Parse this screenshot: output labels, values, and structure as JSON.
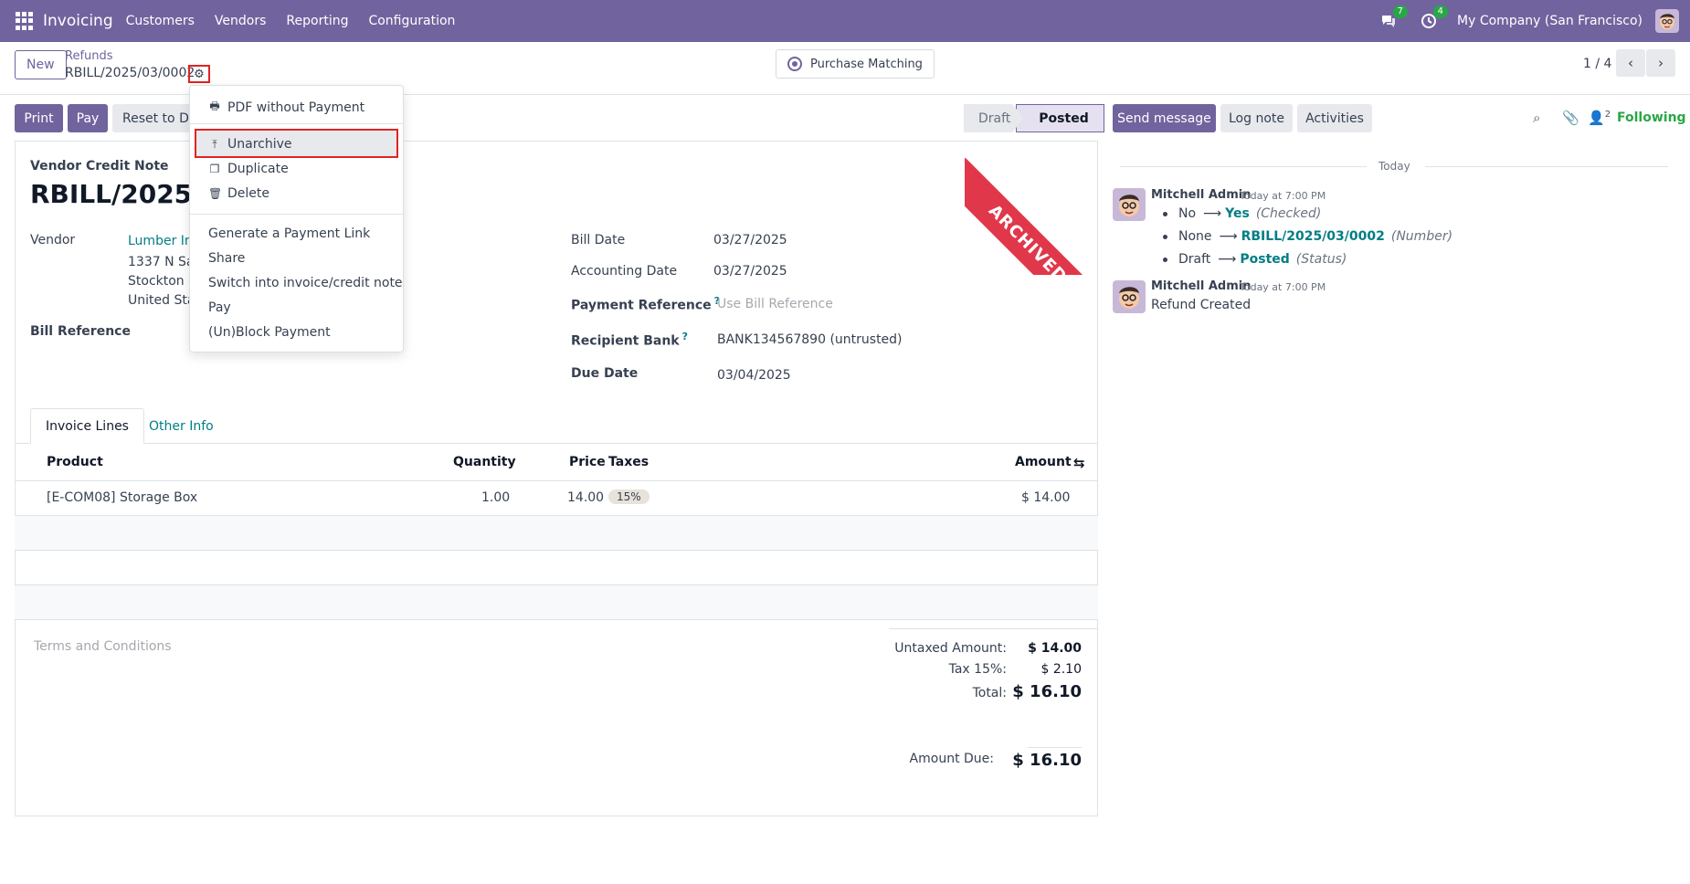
{
  "nav": {
    "app_name": "Invoicing",
    "menu": [
      "Customers",
      "Vendors",
      "Reporting",
      "Configuration"
    ],
    "messages_badge": "7",
    "activities_badge": "4",
    "company": "My Company (San Francisco)"
  },
  "control": {
    "new_label": "New",
    "breadcrumb_parent": "Refunds",
    "breadcrumb_current": "RBILL/2025/03/0002",
    "purchase_matching": "Purchase Matching",
    "pager": "1 / 4"
  },
  "actions": {
    "print": "Print",
    "pay": "Pay",
    "reset": "Reset to Dr"
  },
  "status": {
    "draft": "Draft",
    "posted": "Posted"
  },
  "ribbon": "ARCHIVED",
  "form": {
    "doc_type": "Vendor Credit Note",
    "doc_name": "RBILL/2025/03/0002",
    "vendor_label": "Vendor",
    "vendor_name": "Lumber Inc",
    "vendor_addr1": "1337 N San",
    "vendor_addr2": "Stockton C",
    "vendor_addr3": "United Sta",
    "bill_reference_label": "Bill Reference",
    "bill_date_label": "Bill Date",
    "bill_date": "03/27/2025",
    "accounting_date_label": "Accounting Date",
    "accounting_date": "03/27/2025",
    "payment_reference_label": "Payment Reference",
    "payment_reference_placeholder": "Use Bill Reference",
    "recipient_bank_label": "Recipient Bank",
    "recipient_bank": "BANK134567890 (untrusted)",
    "due_date_label": "Due Date",
    "due_date": "03/04/2025",
    "help_mark": "?"
  },
  "tabs": {
    "invoice_lines": "Invoice Lines",
    "other_info": "Other Info"
  },
  "table": {
    "headers": {
      "product": "Product",
      "quantity": "Quantity",
      "price": "Price",
      "taxes": "Taxes",
      "amount": "Amount"
    },
    "rows": [
      {
        "product": "[E-COM08] Storage Box",
        "quantity": "1.00",
        "price": "14.00",
        "tax": "15%",
        "amount": "$ 14.00"
      }
    ]
  },
  "totals": {
    "terms": "Terms and Conditions",
    "untaxed_label": "Untaxed Amount:",
    "untaxed": "$ 14.00",
    "tax_label": "Tax 15%:",
    "tax": "$ 2.10",
    "total_label": "Total:",
    "total": "$ 16.10",
    "due_label": "Amount Due:",
    "due": "$ 16.10"
  },
  "dropdown": {
    "pdf": "PDF without Payment",
    "unarchive": "Unarchive",
    "duplicate": "Duplicate",
    "delete": "Delete",
    "payment_link": "Generate a Payment Link",
    "share": "Share",
    "switch": "Switch into invoice/credit note",
    "pay": "Pay",
    "block": "(Un)Block Payment"
  },
  "chatter": {
    "send_message": "Send message",
    "log_note": "Log note",
    "activities": "Activities",
    "followers_count": "2",
    "following": "Following",
    "today": "Today",
    "messages": [
      {
        "author": "Mitchell Admin",
        "time": "Today at 7:00 PM",
        "changes": [
          {
            "old": "No",
            "new": "Yes",
            "field": "(Checked)"
          },
          {
            "old": "None",
            "new": "RBILL/2025/03/0002",
            "field": "(Number)"
          },
          {
            "old": "Draft",
            "new": "Posted",
            "field": "(Status)"
          }
        ]
      },
      {
        "author": "Mitchell Admin",
        "time": "Today at 7:00 PM",
        "body": "Refund Created"
      }
    ]
  },
  "colors": {
    "brand": "#71639e",
    "link": "#017e84",
    "ribbon": "#e0384a",
    "highlight": "#e02424",
    "badge": "#28a745"
  }
}
